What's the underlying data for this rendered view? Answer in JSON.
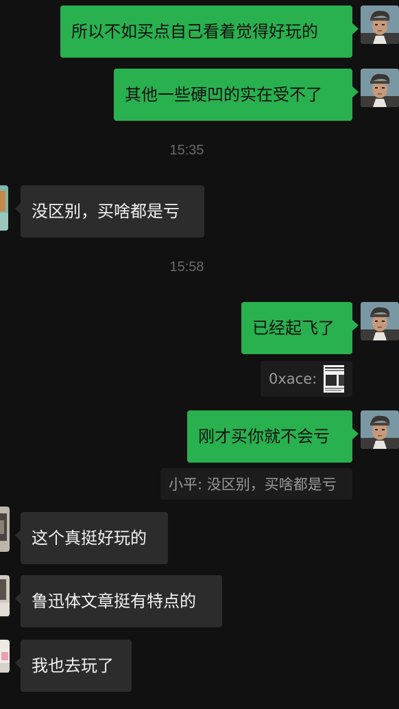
{
  "messages": [
    {
      "text": "所以不如买点自己看着觉得好玩的"
    },
    {
      "text": "其他一些硬凹的实在受不了"
    },
    {
      "text": "没区别，买啥都是亏"
    },
    {
      "text": "已经起飞了"
    },
    {
      "text": "刚才买你就不会亏"
    },
    {
      "text": "这个真挺好玩的"
    },
    {
      "text": "鲁迅体文章挺有特点的"
    },
    {
      "text": "我也去玩了"
    }
  ],
  "timestamps": [
    "15:35",
    "15:58"
  ],
  "quotes": [
    {
      "text": "0xace:"
    },
    {
      "text": "小平: 没区别，买啥都是亏"
    }
  ],
  "colors": {
    "background": "#111111",
    "outgoing_bubble": "#29b04f",
    "incoming_bubble": "#2c2c2c",
    "timestamp": "#6b6b6b",
    "quote_text": "#9a9a9a"
  },
  "icons": {
    "self_avatar": "cartoon-man-avatar",
    "contact_avatar": "cropped-photo-avatar"
  }
}
